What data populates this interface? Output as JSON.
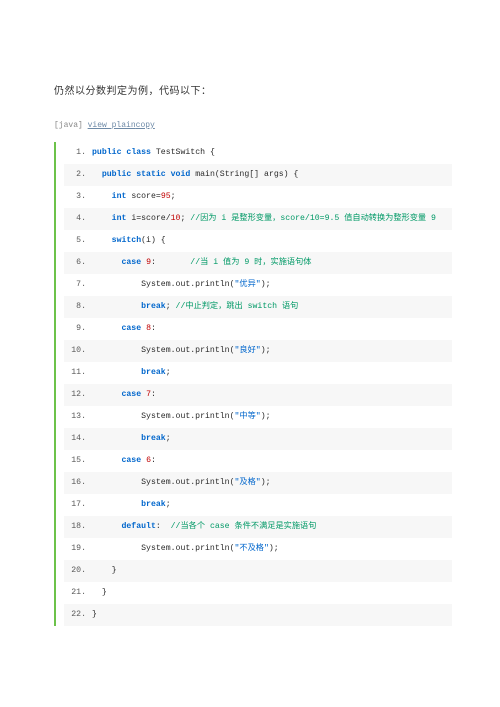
{
  "intro": "仍然以分数判定为例，代码以下：",
  "meta": {
    "lang": "[java]",
    "link1": "view plain",
    "link2": "copy"
  },
  "lines": [
    {
      "n": "1.",
      "indent": "",
      "tokens": [
        [
          "kw",
          "public"
        ],
        [
          "",
          " "
        ],
        [
          "kw",
          "class"
        ],
        [
          "",
          " TestSwitch {"
        ]
      ]
    },
    {
      "n": "2.",
      "indent": "  ",
      "tokens": [
        [
          "kw",
          "public"
        ],
        [
          "",
          " "
        ],
        [
          "kw",
          "static"
        ],
        [
          "",
          " "
        ],
        [
          "kw",
          "void"
        ],
        [
          "",
          " main(String[] args) {"
        ]
      ]
    },
    {
      "n": "3.",
      "indent": "    ",
      "tokens": [
        [
          "kw",
          "int"
        ],
        [
          "",
          " score="
        ],
        [
          "num",
          "95"
        ],
        [
          "",
          ";"
        ]
      ]
    },
    {
      "n": "4.",
      "indent": "    ",
      "tokens": [
        [
          "kw",
          "int"
        ],
        [
          "",
          " i=score/"
        ],
        [
          "num",
          "10"
        ],
        [
          "",
          "; "
        ],
        [
          "cmt",
          "//因为 i 是整形变量，score/10=9.5 值自动转换为整形变量 9"
        ]
      ]
    },
    {
      "n": "5.",
      "indent": "    ",
      "tokens": [
        [
          "kw",
          "switch"
        ],
        [
          "",
          "(i) {"
        ]
      ]
    },
    {
      "n": "6.",
      "indent": "      ",
      "tokens": [
        [
          "kw",
          "case"
        ],
        [
          "",
          " "
        ],
        [
          "num",
          "9"
        ],
        [
          "",
          ":       "
        ],
        [
          "cmt",
          "//当 i 值为 9 时，实施语句体"
        ]
      ]
    },
    {
      "n": "7.",
      "indent": "          ",
      "tokens": [
        [
          "",
          "System.out.println("
        ],
        [
          "str",
          "\"优异\""
        ],
        [
          "",
          ");"
        ]
      ]
    },
    {
      "n": "8.",
      "indent": "          ",
      "tokens": [
        [
          "kw",
          "break"
        ],
        [
          "",
          "; "
        ],
        [
          "cmt",
          "//中止判定，跳出 switch 语句"
        ]
      ]
    },
    {
      "n": "9.",
      "indent": "      ",
      "tokens": [
        [
          "kw",
          "case"
        ],
        [
          "",
          " "
        ],
        [
          "num",
          "8"
        ],
        [
          "",
          ":"
        ]
      ]
    },
    {
      "n": "10.",
      "indent": "          ",
      "tokens": [
        [
          "",
          "System.out.println("
        ],
        [
          "str",
          "\"良好\""
        ],
        [
          "",
          ");"
        ]
      ]
    },
    {
      "n": "11.",
      "indent": "          ",
      "tokens": [
        [
          "kw",
          "break"
        ],
        [
          "",
          ";"
        ]
      ]
    },
    {
      "n": "12.",
      "indent": "      ",
      "tokens": [
        [
          "kw",
          "case"
        ],
        [
          "",
          " "
        ],
        [
          "num",
          "7"
        ],
        [
          "",
          ":"
        ]
      ]
    },
    {
      "n": "13.",
      "indent": "          ",
      "tokens": [
        [
          "",
          "System.out.println("
        ],
        [
          "str",
          "\"中等\""
        ],
        [
          "",
          ");"
        ]
      ]
    },
    {
      "n": "14.",
      "indent": "          ",
      "tokens": [
        [
          "kw",
          "break"
        ],
        [
          "",
          ";"
        ]
      ]
    },
    {
      "n": "15.",
      "indent": "      ",
      "tokens": [
        [
          "kw",
          "case"
        ],
        [
          "",
          " "
        ],
        [
          "num",
          "6"
        ],
        [
          "",
          ":"
        ]
      ]
    },
    {
      "n": "16.",
      "indent": "          ",
      "tokens": [
        [
          "",
          "System.out.println("
        ],
        [
          "str",
          "\"及格\""
        ],
        [
          "",
          ");"
        ]
      ]
    },
    {
      "n": "17.",
      "indent": "          ",
      "tokens": [
        [
          "kw",
          "break"
        ],
        [
          "",
          ";"
        ]
      ]
    },
    {
      "n": "18.",
      "indent": "      ",
      "tokens": [
        [
          "kw",
          "default"
        ],
        [
          "",
          ":  "
        ],
        [
          "cmt",
          "//当各个 case 条件不满足是实施语句"
        ]
      ]
    },
    {
      "n": "19.",
      "indent": "          ",
      "tokens": [
        [
          "",
          "System.out.println("
        ],
        [
          "str",
          "\"不及格\""
        ],
        [
          "",
          ");"
        ]
      ]
    },
    {
      "n": "20.",
      "indent": "    ",
      "tokens": [
        [
          "",
          "}"
        ]
      ]
    },
    {
      "n": "21.",
      "indent": "  ",
      "tokens": [
        [
          "",
          "}"
        ]
      ]
    },
    {
      "n": "22.",
      "indent": "",
      "tokens": [
        [
          "",
          "}"
        ]
      ]
    }
  ]
}
